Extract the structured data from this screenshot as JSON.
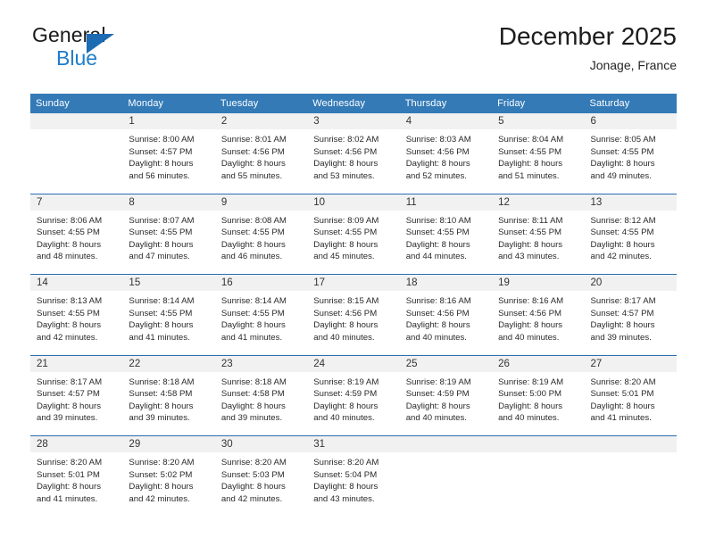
{
  "brand": {
    "word1": "General",
    "word2": "Blue",
    "triangle_color": "#1d6bb3",
    "blue_color": "#1d7ccc"
  },
  "header": {
    "month_title": "December 2025",
    "location": "Jonage, France"
  },
  "theme": {
    "header_blue": "#337ab7",
    "separator_blue": "#2a6ead",
    "daynum_gray": "#f1f1f1"
  },
  "weekday_headers": [
    "Sunday",
    "Monday",
    "Tuesday",
    "Wednesday",
    "Thursday",
    "Friday",
    "Saturday"
  ],
  "weeks": [
    {
      "days": [
        {
          "num": "",
          "lines": []
        },
        {
          "num": "1",
          "lines": [
            "Sunrise: 8:00 AM",
            "Sunset: 4:57 PM",
            "Daylight: 8 hours",
            "and 56 minutes."
          ]
        },
        {
          "num": "2",
          "lines": [
            "Sunrise: 8:01 AM",
            "Sunset: 4:56 PM",
            "Daylight: 8 hours",
            "and 55 minutes."
          ]
        },
        {
          "num": "3",
          "lines": [
            "Sunrise: 8:02 AM",
            "Sunset: 4:56 PM",
            "Daylight: 8 hours",
            "and 53 minutes."
          ]
        },
        {
          "num": "4",
          "lines": [
            "Sunrise: 8:03 AM",
            "Sunset: 4:56 PM",
            "Daylight: 8 hours",
            "and 52 minutes."
          ]
        },
        {
          "num": "5",
          "lines": [
            "Sunrise: 8:04 AM",
            "Sunset: 4:55 PM",
            "Daylight: 8 hours",
            "and 51 minutes."
          ]
        },
        {
          "num": "6",
          "lines": [
            "Sunrise: 8:05 AM",
            "Sunset: 4:55 PM",
            "Daylight: 8 hours",
            "and 49 minutes."
          ]
        }
      ]
    },
    {
      "days": [
        {
          "num": "7",
          "lines": [
            "Sunrise: 8:06 AM",
            "Sunset: 4:55 PM",
            "Daylight: 8 hours",
            "and 48 minutes."
          ]
        },
        {
          "num": "8",
          "lines": [
            "Sunrise: 8:07 AM",
            "Sunset: 4:55 PM",
            "Daylight: 8 hours",
            "and 47 minutes."
          ]
        },
        {
          "num": "9",
          "lines": [
            "Sunrise: 8:08 AM",
            "Sunset: 4:55 PM",
            "Daylight: 8 hours",
            "and 46 minutes."
          ]
        },
        {
          "num": "10",
          "lines": [
            "Sunrise: 8:09 AM",
            "Sunset: 4:55 PM",
            "Daylight: 8 hours",
            "and 45 minutes."
          ]
        },
        {
          "num": "11",
          "lines": [
            "Sunrise: 8:10 AM",
            "Sunset: 4:55 PM",
            "Daylight: 8 hours",
            "and 44 minutes."
          ]
        },
        {
          "num": "12",
          "lines": [
            "Sunrise: 8:11 AM",
            "Sunset: 4:55 PM",
            "Daylight: 8 hours",
            "and 43 minutes."
          ]
        },
        {
          "num": "13",
          "lines": [
            "Sunrise: 8:12 AM",
            "Sunset: 4:55 PM",
            "Daylight: 8 hours",
            "and 42 minutes."
          ]
        }
      ]
    },
    {
      "days": [
        {
          "num": "14",
          "lines": [
            "Sunrise: 8:13 AM",
            "Sunset: 4:55 PM",
            "Daylight: 8 hours",
            "and 42 minutes."
          ]
        },
        {
          "num": "15",
          "lines": [
            "Sunrise: 8:14 AM",
            "Sunset: 4:55 PM",
            "Daylight: 8 hours",
            "and 41 minutes."
          ]
        },
        {
          "num": "16",
          "lines": [
            "Sunrise: 8:14 AM",
            "Sunset: 4:55 PM",
            "Daylight: 8 hours",
            "and 41 minutes."
          ]
        },
        {
          "num": "17",
          "lines": [
            "Sunrise: 8:15 AM",
            "Sunset: 4:56 PM",
            "Daylight: 8 hours",
            "and 40 minutes."
          ]
        },
        {
          "num": "18",
          "lines": [
            "Sunrise: 8:16 AM",
            "Sunset: 4:56 PM",
            "Daylight: 8 hours",
            "and 40 minutes."
          ]
        },
        {
          "num": "19",
          "lines": [
            "Sunrise: 8:16 AM",
            "Sunset: 4:56 PM",
            "Daylight: 8 hours",
            "and 40 minutes."
          ]
        },
        {
          "num": "20",
          "lines": [
            "Sunrise: 8:17 AM",
            "Sunset: 4:57 PM",
            "Daylight: 8 hours",
            "and 39 minutes."
          ]
        }
      ]
    },
    {
      "days": [
        {
          "num": "21",
          "lines": [
            "Sunrise: 8:17 AM",
            "Sunset: 4:57 PM",
            "Daylight: 8 hours",
            "and 39 minutes."
          ]
        },
        {
          "num": "22",
          "lines": [
            "Sunrise: 8:18 AM",
            "Sunset: 4:58 PM",
            "Daylight: 8 hours",
            "and 39 minutes."
          ]
        },
        {
          "num": "23",
          "lines": [
            "Sunrise: 8:18 AM",
            "Sunset: 4:58 PM",
            "Daylight: 8 hours",
            "and 39 minutes."
          ]
        },
        {
          "num": "24",
          "lines": [
            "Sunrise: 8:19 AM",
            "Sunset: 4:59 PM",
            "Daylight: 8 hours",
            "and 40 minutes."
          ]
        },
        {
          "num": "25",
          "lines": [
            "Sunrise: 8:19 AM",
            "Sunset: 4:59 PM",
            "Daylight: 8 hours",
            "and 40 minutes."
          ]
        },
        {
          "num": "26",
          "lines": [
            "Sunrise: 8:19 AM",
            "Sunset: 5:00 PM",
            "Daylight: 8 hours",
            "and 40 minutes."
          ]
        },
        {
          "num": "27",
          "lines": [
            "Sunrise: 8:20 AM",
            "Sunset: 5:01 PM",
            "Daylight: 8 hours",
            "and 41 minutes."
          ]
        }
      ]
    },
    {
      "days": [
        {
          "num": "28",
          "lines": [
            "Sunrise: 8:20 AM",
            "Sunset: 5:01 PM",
            "Daylight: 8 hours",
            "and 41 minutes."
          ]
        },
        {
          "num": "29",
          "lines": [
            "Sunrise: 8:20 AM",
            "Sunset: 5:02 PM",
            "Daylight: 8 hours",
            "and 42 minutes."
          ]
        },
        {
          "num": "30",
          "lines": [
            "Sunrise: 8:20 AM",
            "Sunset: 5:03 PM",
            "Daylight: 8 hours",
            "and 42 minutes."
          ]
        },
        {
          "num": "31",
          "lines": [
            "Sunrise: 8:20 AM",
            "Sunset: 5:04 PM",
            "Daylight: 8 hours",
            "and 43 minutes."
          ]
        },
        {
          "num": "",
          "lines": []
        },
        {
          "num": "",
          "lines": []
        },
        {
          "num": "",
          "lines": []
        }
      ]
    }
  ]
}
